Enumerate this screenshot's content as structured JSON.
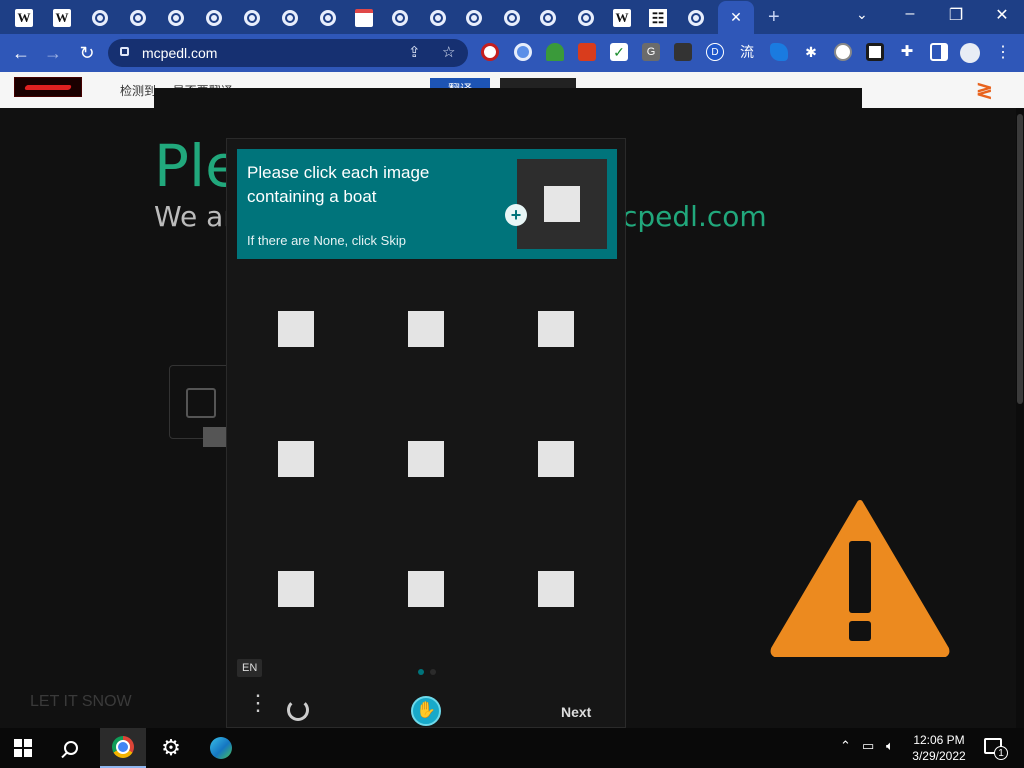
{
  "browser": {
    "url": "mcpedl.com",
    "tabs": [
      {
        "icon": "wikipedia-icon",
        "letter": "W"
      },
      {
        "icon": "wikipedia-icon",
        "letter": "W"
      },
      {
        "icon": "chrome-icon"
      },
      {
        "icon": "chrome-icon"
      },
      {
        "icon": "chrome-icon"
      },
      {
        "icon": "chrome-icon"
      },
      {
        "icon": "chrome-icon"
      },
      {
        "icon": "chrome-icon"
      },
      {
        "icon": "chrome-icon"
      },
      {
        "icon": "gallery-icon"
      },
      {
        "icon": "chrome-icon"
      },
      {
        "icon": "chrome-icon"
      },
      {
        "icon": "chrome-icon"
      },
      {
        "icon": "chrome-icon"
      },
      {
        "icon": "chrome-icon"
      },
      {
        "icon": "chrome-icon"
      },
      {
        "icon": "wikipedia-icon",
        "letter": "W"
      },
      {
        "icon": "reader-icon"
      },
      {
        "icon": "chrome-icon"
      }
    ],
    "active_tab_close": "✕",
    "new_tab": "+",
    "tab_menu": "⌄",
    "window_buttons": [
      "–",
      "❐",
      "✕"
    ],
    "extension_letters": [
      "G",
      "D",
      "流"
    ],
    "colors": {
      "tabstrip": "#1e3f86",
      "toolbar": "#2f57b8",
      "omnibox": "#163071"
    }
  },
  "banner": {
    "text": "检测到 ... 是否要翻译",
    "button": "翻译",
    "extra": "",
    "right_icon": "≷"
  },
  "page": {
    "headline": "Ple",
    "subhead_left": "We ar",
    "subhead_right": "cpedl.com",
    "snow": "LET IT SNOW",
    "accent": "#21a87c"
  },
  "captcha": {
    "prompt": "Please click each image containing a boat",
    "hint": "If there are None, click Skip",
    "language": "EN",
    "next": "Next",
    "menu_glyph": "⋮",
    "header_color": "#00747b",
    "tile_count": 9
  },
  "warning": {
    "color": "#ec8a1f",
    "icon": "warning-icon"
  },
  "taskbar": {
    "time": "12:06 PM",
    "date": "3/29/2022",
    "notification_count": "1"
  }
}
